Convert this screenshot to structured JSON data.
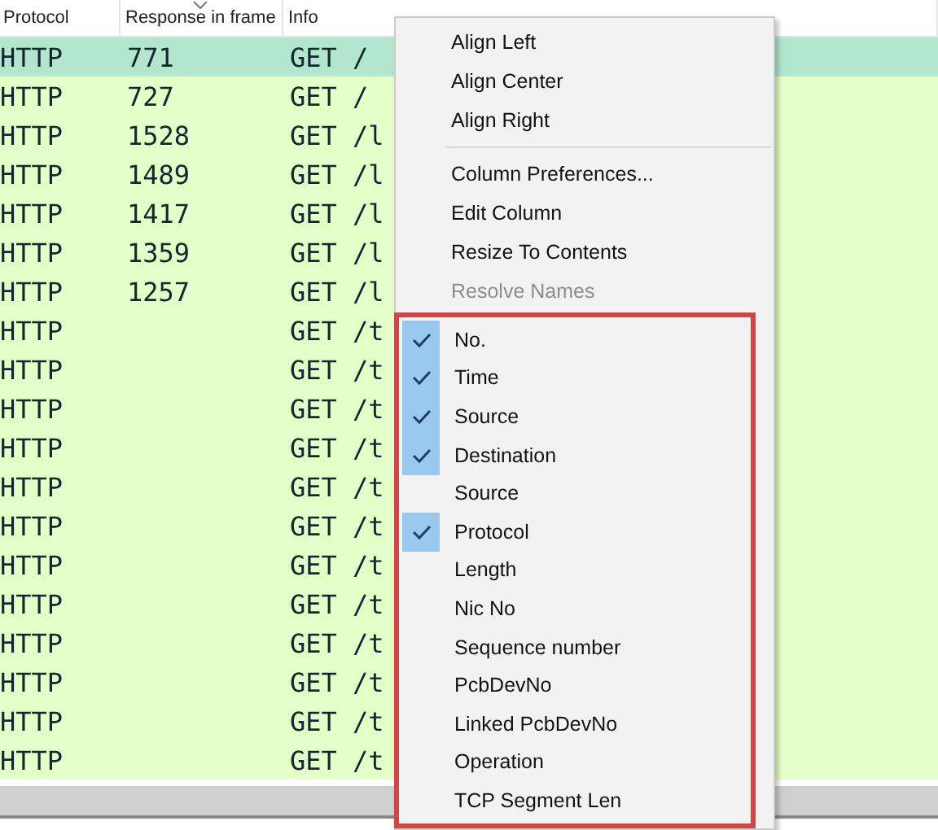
{
  "table": {
    "columns": [
      {
        "label": "Protocol",
        "sorted": false
      },
      {
        "label": "Response in frame",
        "sorted": true
      },
      {
        "label": "Info",
        "sorted": false
      }
    ],
    "rows": [
      {
        "protocol": "HTTP",
        "response": "771",
        "info": "GET /",
        "selected": true
      },
      {
        "protocol": "HTTP",
        "response": "727",
        "info": "GET /",
        "selected": false
      },
      {
        "protocol": "HTTP",
        "response": "1528",
        "info": "GET /l",
        "selected": false
      },
      {
        "protocol": "HTTP",
        "response": "1489",
        "info": "GET /l",
        "selected": false
      },
      {
        "protocol": "HTTP",
        "response": "1417",
        "info": "GET /l",
        "selected": false
      },
      {
        "protocol": "HTTP",
        "response": "1359",
        "info": "GET /l",
        "selected": false
      },
      {
        "protocol": "HTTP",
        "response": "1257",
        "info": "GET /l",
        "selected": false
      },
      {
        "protocol": "HTTP",
        "info": "GET /t",
        "selected": false
      },
      {
        "protocol": "HTTP",
        "info": "GET /t",
        "selected": false
      },
      {
        "protocol": "HTTP",
        "info": "GET /t",
        "selected": false
      },
      {
        "protocol": "HTTP",
        "info": "GET /t",
        "selected": false
      },
      {
        "protocol": "HTTP",
        "info": "GET /t",
        "selected": false
      },
      {
        "protocol": "HTTP",
        "info": "GET /t",
        "selected": false
      },
      {
        "protocol": "HTTP",
        "info": "GET /t",
        "selected": false
      },
      {
        "protocol": "HTTP",
        "info": "GET /t",
        "selected": false
      },
      {
        "protocol": "HTTP",
        "info": "GET /t",
        "selected": false
      },
      {
        "protocol": "HTTP",
        "info": "GET /t",
        "selected": false
      },
      {
        "protocol": "HTTP",
        "info": "GET /t",
        "selected": false
      },
      {
        "protocol": "HTTP",
        "info": "GET /t",
        "selected": false
      }
    ]
  },
  "context_menu": {
    "groups": [
      {
        "kind": "plain",
        "items": [
          {
            "label": "Align Left",
            "disabled": false
          },
          {
            "label": "Align Center",
            "disabled": false
          },
          {
            "label": "Align Right",
            "disabled": false
          }
        ]
      },
      {
        "kind": "plain",
        "items": [
          {
            "label": "Column Preferences...",
            "disabled": false
          },
          {
            "label": "Edit Column",
            "disabled": false
          },
          {
            "label": "Resize To Contents",
            "disabled": false
          },
          {
            "label": "Resolve Names",
            "disabled": true
          }
        ]
      },
      {
        "kind": "checklist",
        "highlighted": true,
        "items": [
          {
            "label": "No.",
            "checked": true
          },
          {
            "label": "Time",
            "checked": true
          },
          {
            "label": "Source",
            "checked": true
          },
          {
            "label": "Destination",
            "checked": true
          },
          {
            "label": "Source",
            "checked": false
          },
          {
            "label": "Protocol",
            "checked": true
          },
          {
            "label": "Length",
            "checked": false
          },
          {
            "label": "Nic No",
            "checked": false
          },
          {
            "label": "Sequence number",
            "checked": false
          },
          {
            "label": "PcbDevNo",
            "checked": false
          },
          {
            "label": "Linked PcbDevNo",
            "checked": false
          },
          {
            "label": "Operation",
            "checked": false
          },
          {
            "label": "TCP Segment Len",
            "checked": false
          }
        ]
      }
    ]
  }
}
